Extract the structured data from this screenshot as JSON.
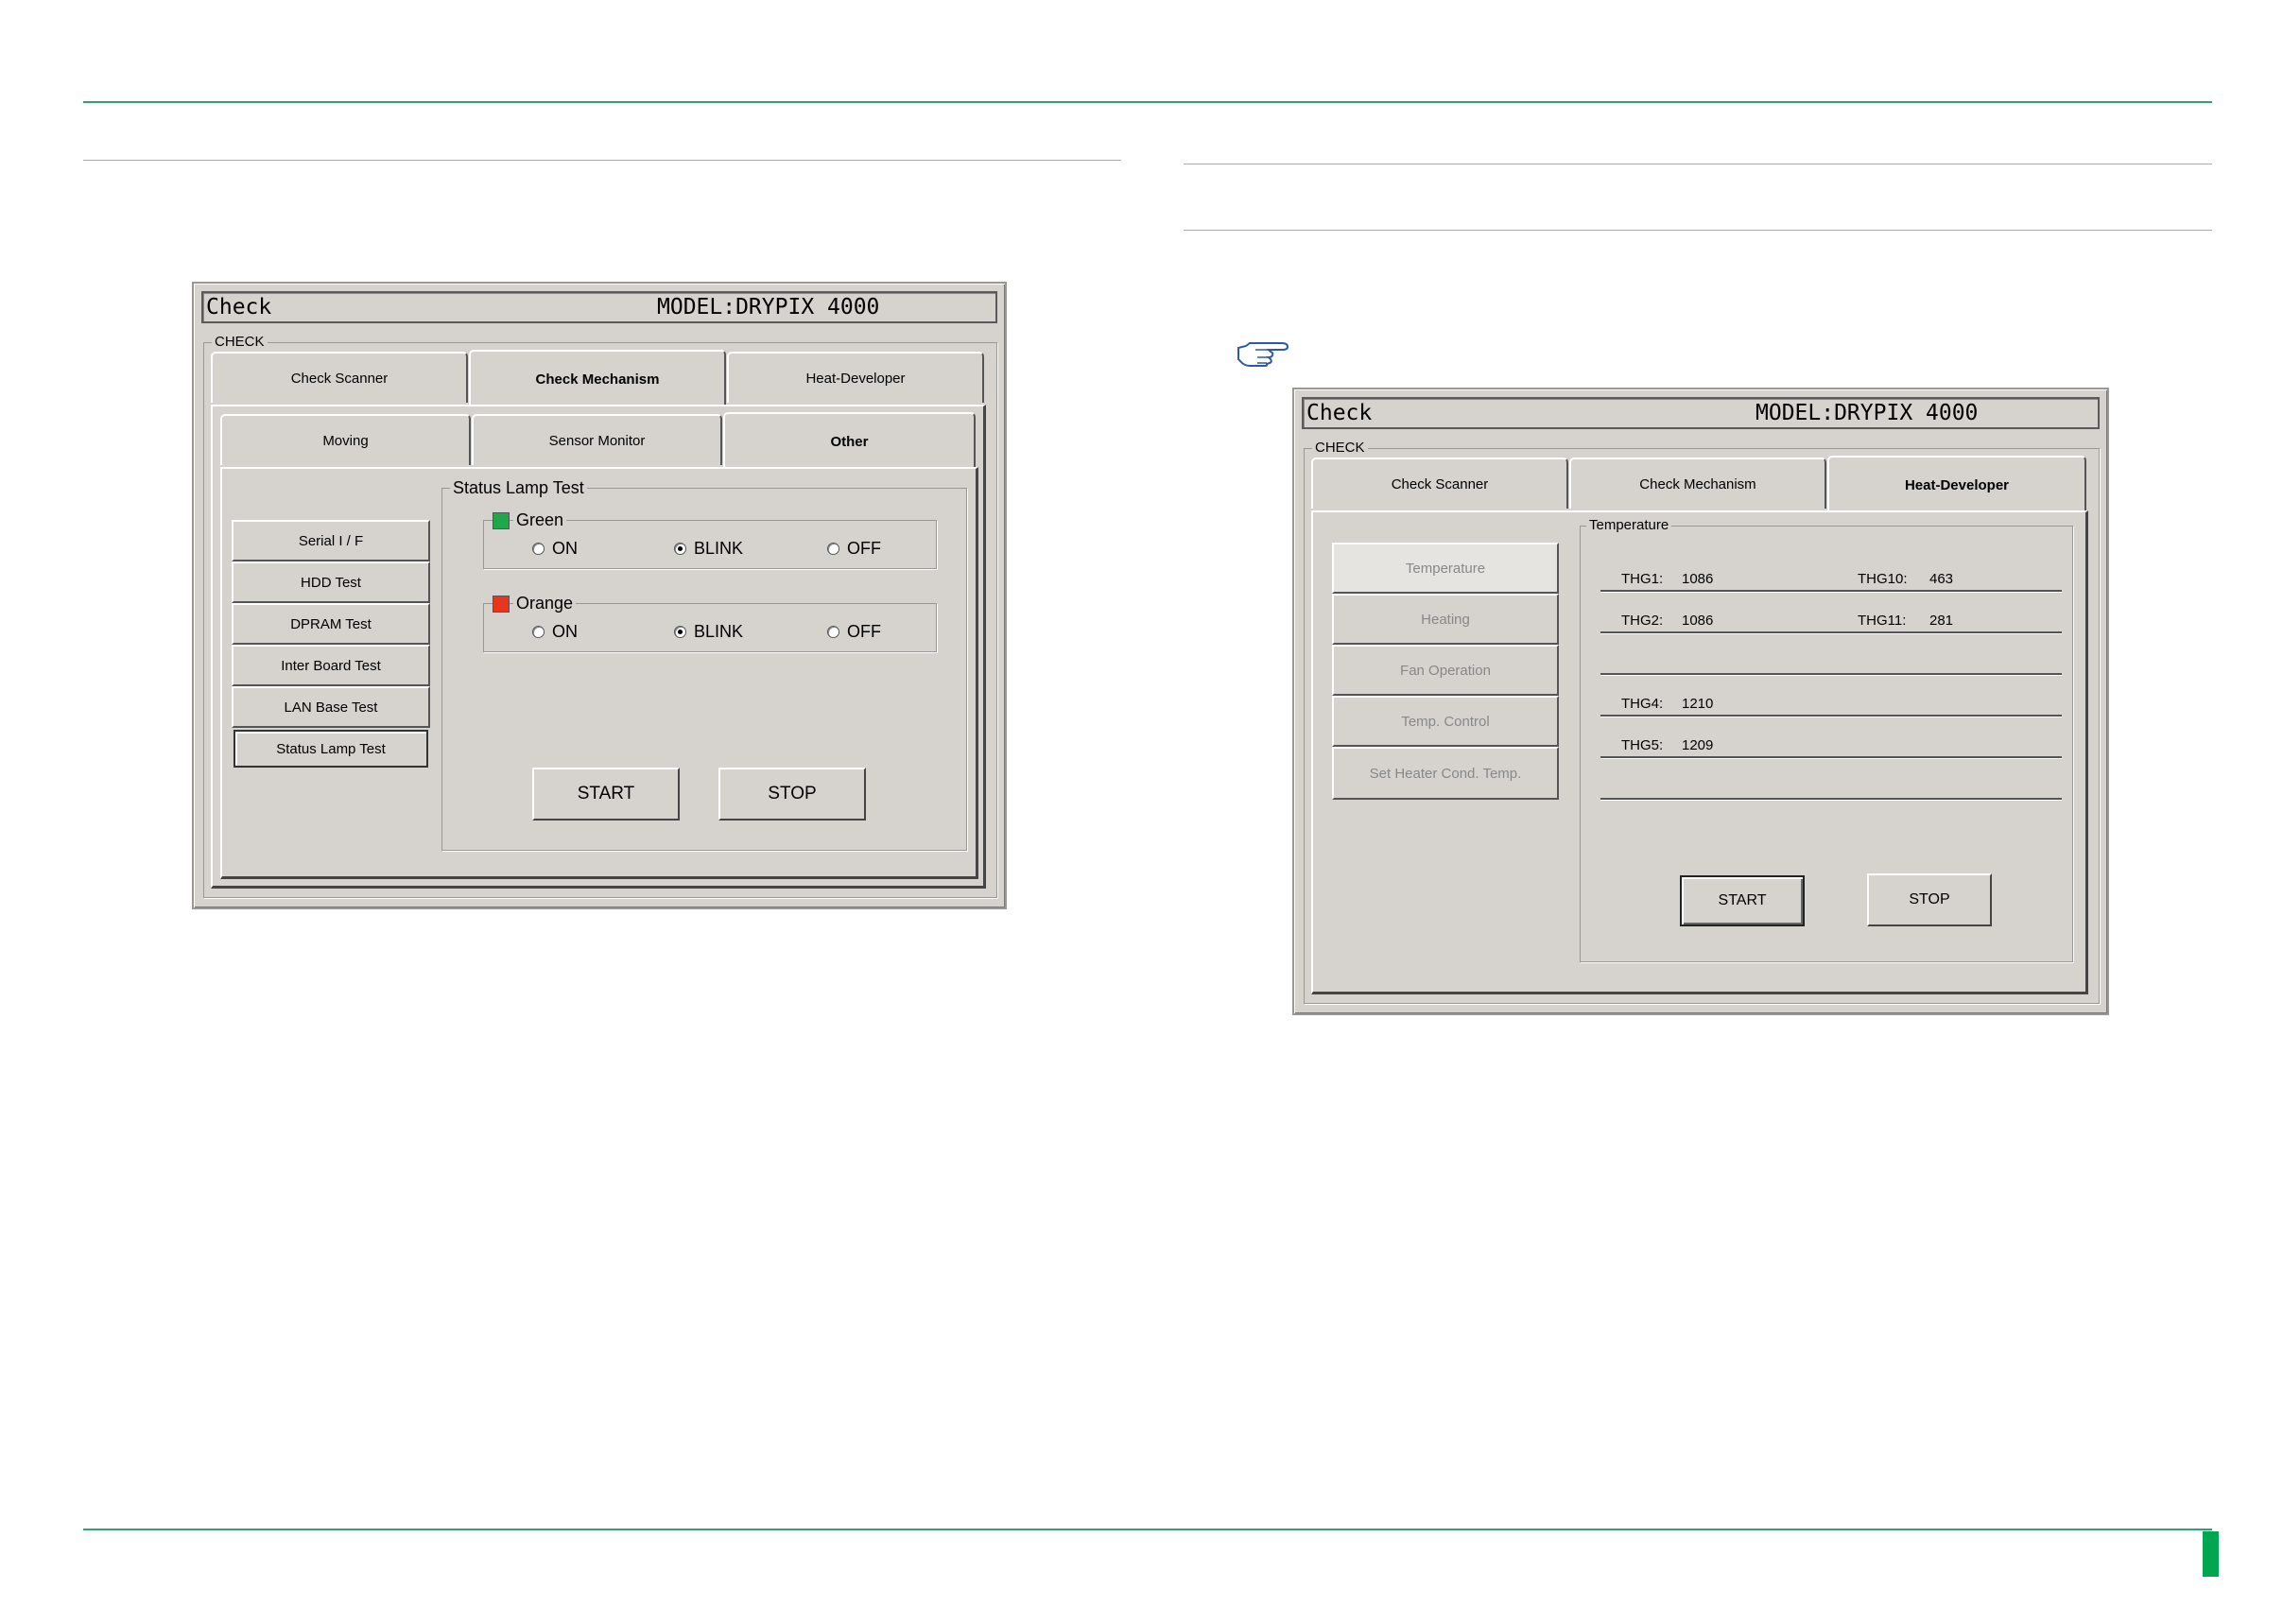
{
  "colors": {
    "rule_green": "#2aa56b",
    "rule_gray": "#a9a9a9",
    "accent_green": "#00a650",
    "lamp_green": "#1ea84a",
    "lamp_orange": "#e8351e",
    "window_bg": "#d6d3ce",
    "pointer_icon": "#2d5aa8"
  },
  "left_window": {
    "title": "Check",
    "model": "MODEL:DRYPIX 4000",
    "group_label": "CHECK",
    "top_tabs": [
      {
        "label": "Check Scanner",
        "active": false
      },
      {
        "label": "Check Mechanism",
        "active": true
      },
      {
        "label": "Heat-Developer",
        "active": false
      }
    ],
    "sub_tabs": [
      {
        "label": "Moving",
        "active": false
      },
      {
        "label": "Sensor Monitor",
        "active": false
      },
      {
        "label": "Other",
        "active": true
      }
    ],
    "side_buttons": [
      {
        "label": "Serial I / F"
      },
      {
        "label": "HDD Test"
      },
      {
        "label": "DPRAM Test"
      },
      {
        "label": "Inter Board Test"
      },
      {
        "label": "LAN Base Test"
      },
      {
        "label": "Status Lamp Test",
        "selected": true
      }
    ],
    "status_group_label": "Status Lamp Test",
    "lamps": [
      {
        "name": "Green",
        "color": "#1ea84a",
        "options": [
          "ON",
          "BLINK",
          "OFF"
        ],
        "selected": "BLINK"
      },
      {
        "name": "Orange",
        "color": "#e8351e",
        "options": [
          "ON",
          "BLINK",
          "OFF"
        ],
        "selected": "BLINK"
      }
    ],
    "start_label": "START",
    "stop_label": "STOP"
  },
  "right_window": {
    "pointer_icon": "pointing-hand-icon",
    "title": "Check",
    "model": "MODEL:DRYPIX 4000",
    "group_label": "CHECK",
    "top_tabs": [
      {
        "label": "Check Scanner",
        "active": false
      },
      {
        "label": "Check Mechanism",
        "active": false
      },
      {
        "label": "Heat-Developer",
        "active": true
      }
    ],
    "side_buttons": [
      {
        "label": "Temperature",
        "selected": true
      },
      {
        "label": "Heating"
      },
      {
        "label": "Fan Operation"
      },
      {
        "label": "Temp. Control"
      },
      {
        "label": "Set Heater Cond. Temp."
      }
    ],
    "temperature_group_label": "Temperature",
    "readings": [
      {
        "a_label": "THG1:",
        "a_value": "1086",
        "b_label": "THG10:",
        "b_value": "463"
      },
      {
        "a_label": "THG2:",
        "a_value": "1086",
        "b_label": "THG11:",
        "b_value": "281"
      },
      {
        "a_label": "",
        "a_value": "",
        "b_label": "",
        "b_value": ""
      },
      {
        "a_label": "THG4:",
        "a_value": "1210",
        "b_label": "",
        "b_value": ""
      },
      {
        "a_label": "THG5:",
        "a_value": "1209",
        "b_label": "",
        "b_value": ""
      },
      {
        "a_label": "",
        "a_value": "",
        "b_label": "",
        "b_value": ""
      }
    ],
    "start_label": "START",
    "stop_label": "STOP"
  }
}
